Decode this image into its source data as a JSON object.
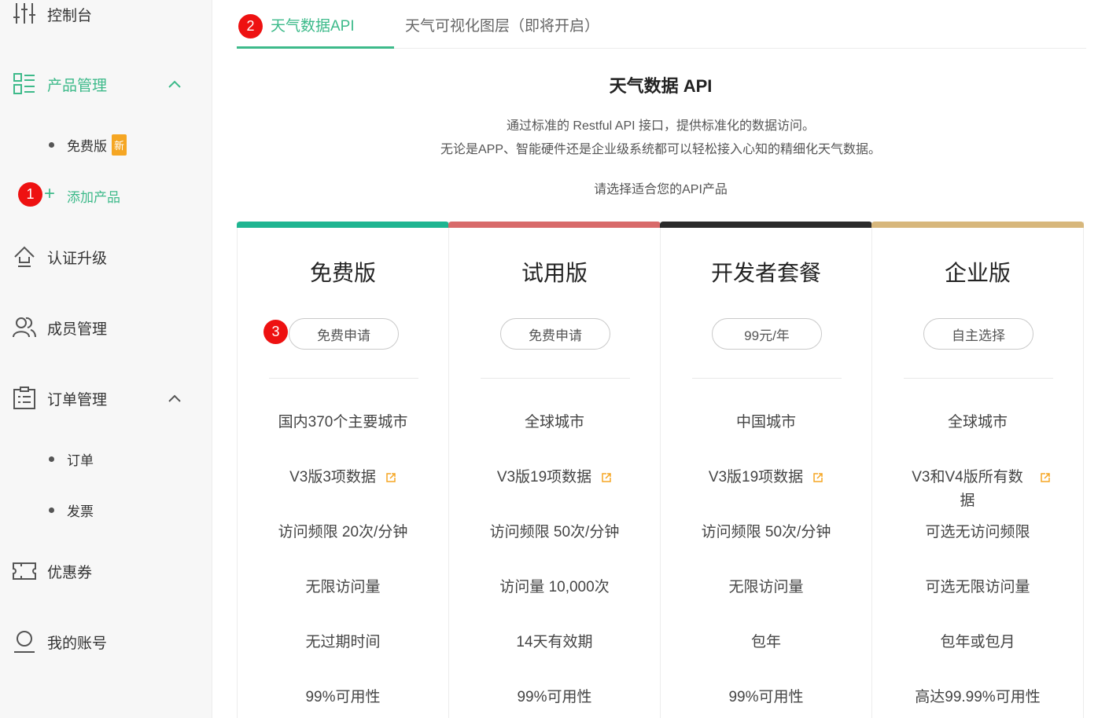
{
  "sidebar": {
    "items": [
      {
        "label": "控制台"
      },
      {
        "label": "产品管理"
      },
      {
        "label": "认证升级"
      },
      {
        "label": "成员管理"
      },
      {
        "label": "订单管理"
      },
      {
        "label": "优惠券"
      },
      {
        "label": "我的账号"
      }
    ],
    "product_sub": [
      {
        "label": "免费版",
        "badge": "新"
      }
    ],
    "add_product": "添加产品",
    "order_sub": [
      {
        "label": "订单"
      },
      {
        "label": "发票"
      }
    ]
  },
  "markers": [
    "1",
    "2",
    "3"
  ],
  "tabs": [
    {
      "label": "天气数据API"
    },
    {
      "label": "天气可视化图层（即将开启）"
    }
  ],
  "header": {
    "title": "天气数据 API",
    "desc1": "通过标准的 Restful API 接口，提供标准化的数据访问。",
    "desc2": "无论是APP、智能硬件还是企业级系统都可以轻松接入心知的精细化天气数据。",
    "prompt": "请选择适合您的API产品"
  },
  "colors": {
    "accent": "#3dba8a",
    "plan_free": "#1fb591",
    "plan_trial": "#d86a6a",
    "plan_dev": "#2b2b2b",
    "plan_enterprise": "#d7b77c",
    "marker": "#ee1111",
    "badge": "#f5a623"
  },
  "icons": {
    "dashboard": "sliders-icon",
    "product": "grid-list-icon",
    "upgrade": "upgrade-icon",
    "members": "users-icon",
    "orders": "clipboard-icon",
    "coupon": "ticket-icon",
    "account": "user-icon",
    "external": "external-link-icon"
  },
  "plans": [
    {
      "name": "免费版",
      "button": "免费申请",
      "features": [
        "国内370个主要城市",
        "V3版3项数据",
        "访问频限 20次/分钟",
        "无限访问量",
        "无过期时间",
        "99%可用性"
      ]
    },
    {
      "name": "试用版",
      "button": "免费申请",
      "features": [
        "全球城市",
        "V3版19项数据",
        "访问频限 50次/分钟",
        "访问量 10,000次",
        "14天有效期",
        "99%可用性"
      ]
    },
    {
      "name": "开发者套餐",
      "button": "99元/年",
      "features": [
        "中国城市",
        "V3版19项数据",
        "访问频限 50次/分钟",
        "无限访问量",
        "包年",
        "99%可用性"
      ]
    },
    {
      "name": "企业版",
      "button": "自主选择",
      "features": [
        "全球城市",
        "V3和V4版所有数据",
        "可选无访问频限",
        "可选无限访问量",
        "包年或包月",
        "高达99.99%可用性"
      ]
    }
  ]
}
